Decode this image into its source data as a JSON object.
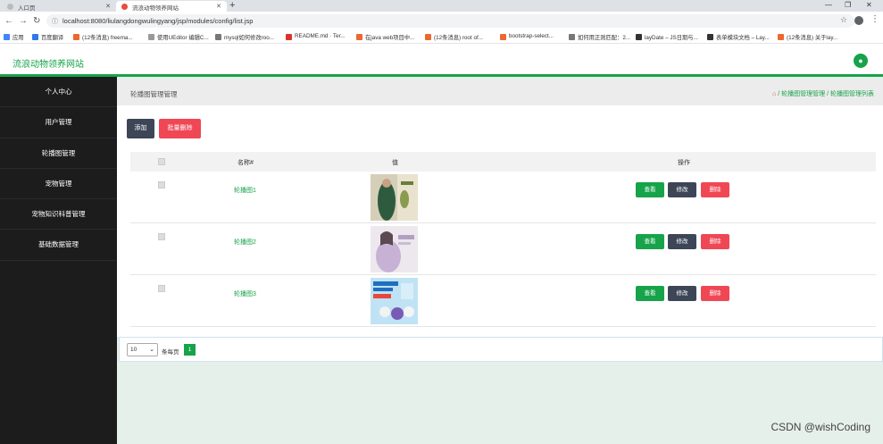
{
  "browser": {
    "tabs": [
      {
        "title": "入口页",
        "active": false
      },
      {
        "title": "流浪动物领养网站",
        "active": true
      }
    ],
    "new_tab": "+",
    "url": "localhost:8080/liulangdongwulingyang/jsp/modules/config/list.jsp",
    "bookmarks": [
      {
        "label": "应用",
        "color": "#4285f4"
      },
      {
        "label": "百度翻译",
        "color": "#2f7ae5"
      },
      {
        "label": "(12条消息) freema...",
        "color": "#e86a2e"
      },
      {
        "label": "使用UEditor 编辑C...",
        "color": "#999999"
      },
      {
        "label": "mysql如何修改roo...",
        "color": "#777777"
      },
      {
        "label": "README.md · Ter...",
        "color": "#d9342b"
      },
      {
        "label": "在java web项目中...",
        "color": "#e86a2e"
      },
      {
        "label": "(12条消息) root of...",
        "color": "#e86a2e"
      },
      {
        "label": "bootstrap-select...",
        "color": "#e86a2e"
      },
      {
        "label": "如何用正则匹配：2...",
        "color": "#777777"
      },
      {
        "label": "layDate – JS日期与...",
        "color": "#333333"
      },
      {
        "label": "表单模块文档 – Lay...",
        "color": "#333333"
      },
      {
        "label": "(12条消息) 关于lay...",
        "color": "#e86a2e"
      }
    ]
  },
  "app": {
    "site_title": "流浪动物领养网站",
    "user_icon": "user-icon"
  },
  "sidebar": {
    "items": [
      {
        "label": "个人中心"
      },
      {
        "label": "用户管理"
      },
      {
        "label": "轮播图管理"
      },
      {
        "label": "宠物管理"
      },
      {
        "label": "宠物知识科普管理"
      },
      {
        "label": "基础数据管理"
      }
    ]
  },
  "main": {
    "page_heading": "轮播图管理管理",
    "breadcrumb": {
      "sep": " / ",
      "parent": "轮播图管理管理",
      "current": "轮播图管理列表"
    },
    "toolbar": {
      "add_label": "添加",
      "batch_delete_label": "批量删除"
    },
    "table": {
      "headers": {
        "name": "名称#",
        "value": "值",
        "actions": "操作"
      },
      "rows": [
        {
          "name": "轮播图1"
        },
        {
          "name": "轮播图2"
        },
        {
          "name": "轮播图3"
        }
      ],
      "actions": {
        "view": "查看",
        "edit": "修改",
        "delete": "删除"
      }
    },
    "pager": {
      "page_size": "10",
      "per_page_label": "条每页",
      "current_page": "1"
    }
  },
  "watermark": "CSDN @wishCoding",
  "colors": {
    "brand": "#16a34a",
    "sidebar_bg": "#1c1c1c",
    "danger": "#f04755",
    "dark_button": "#3d4657"
  }
}
